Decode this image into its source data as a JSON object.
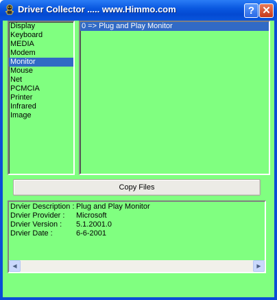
{
  "window": {
    "title": "Driver Collector ..... www.Himmo.com",
    "help_label": "?",
    "close_label": "✕"
  },
  "categories": {
    "items": [
      "Display",
      "Keyboard",
      "MEDIA",
      "Modem",
      "Monitor",
      "Mouse",
      "Net",
      "PCMCIA",
      "Printer",
      "Infrared",
      "Image"
    ],
    "selected": "Monitor"
  },
  "drivers": {
    "items": [
      "0 => Plug and Play Monitor"
    ]
  },
  "copy_button": {
    "label": "Copy Files"
  },
  "details": {
    "description_label": "Drvier Description :",
    "description_value": "Plug and Play Monitor",
    "provider_label": "Drvier Provider :",
    "provider_value": "Microsoft",
    "version_label": "Drvier Version :",
    "version_value": "5.1.2001.0",
    "date_label": "Drvier Date :",
    "date_value": "6-6-2001"
  },
  "scrollbar": {
    "left_arrow": "◀",
    "right_arrow": "▶"
  },
  "colors": {
    "background": "#80ff80",
    "selection": "#316ac5",
    "titlebar": "#0a58e0"
  }
}
